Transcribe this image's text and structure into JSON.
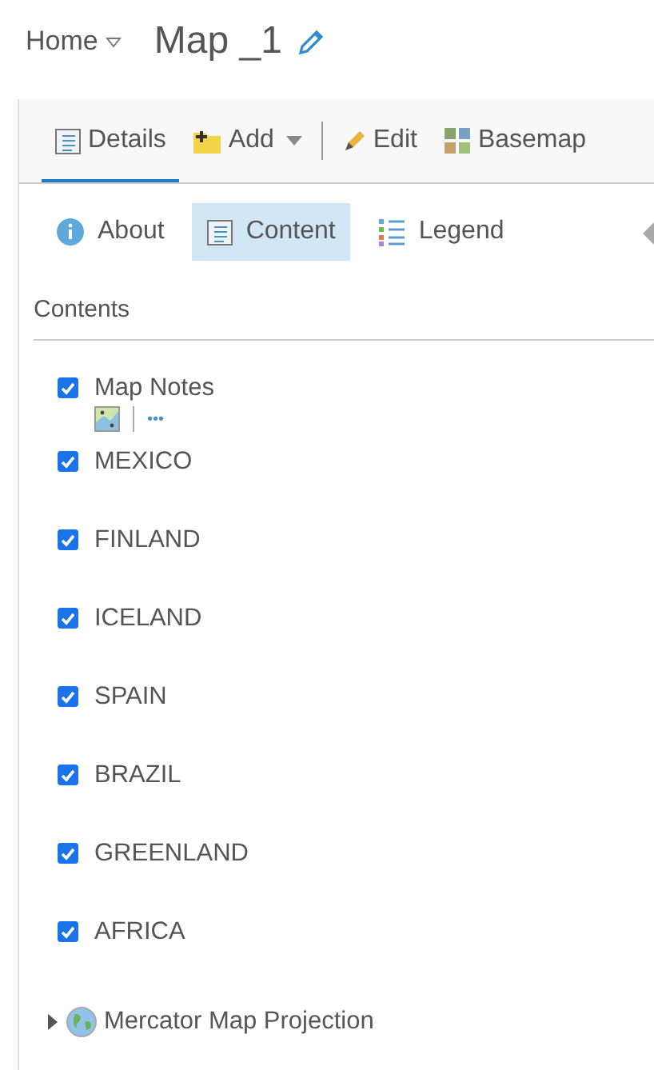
{
  "header": {
    "home": "Home",
    "title": "Map _1"
  },
  "toolbar": [
    {
      "label": "Details",
      "kind": "details",
      "selected": true,
      "caret": false
    },
    {
      "label": "Add",
      "kind": "add",
      "selected": false,
      "caret": true
    },
    {
      "label": "Edit",
      "kind": "edit",
      "selected": false,
      "caret": false
    },
    {
      "label": "Basemap",
      "kind": "basemap",
      "selected": false,
      "caret": false
    }
  ],
  "tabs": [
    {
      "label": "About",
      "kind": "about",
      "selected": false
    },
    {
      "label": "Content",
      "kind": "content",
      "selected": true
    },
    {
      "label": "Legend",
      "kind": "legend",
      "selected": false
    }
  ],
  "contents": {
    "heading": "Contents",
    "layers": [
      {
        "name": "Map Notes",
        "kind": "notes",
        "checked": true,
        "more": "•••"
      },
      {
        "name": "MEXICO",
        "kind": "layer",
        "checked": true
      },
      {
        "name": "FINLAND",
        "kind": "layer",
        "checked": true
      },
      {
        "name": "ICELAND",
        "kind": "layer",
        "checked": true
      },
      {
        "name": "SPAIN",
        "kind": "layer",
        "checked": true
      },
      {
        "name": "BRAZIL",
        "kind": "layer",
        "checked": true
      },
      {
        "name": "GREENLAND",
        "kind": "layer",
        "checked": true
      },
      {
        "name": "AFRICA",
        "kind": "layer",
        "checked": true
      },
      {
        "name": "Mercator Map Projection",
        "kind": "basemap",
        "expanded": false
      }
    ]
  }
}
